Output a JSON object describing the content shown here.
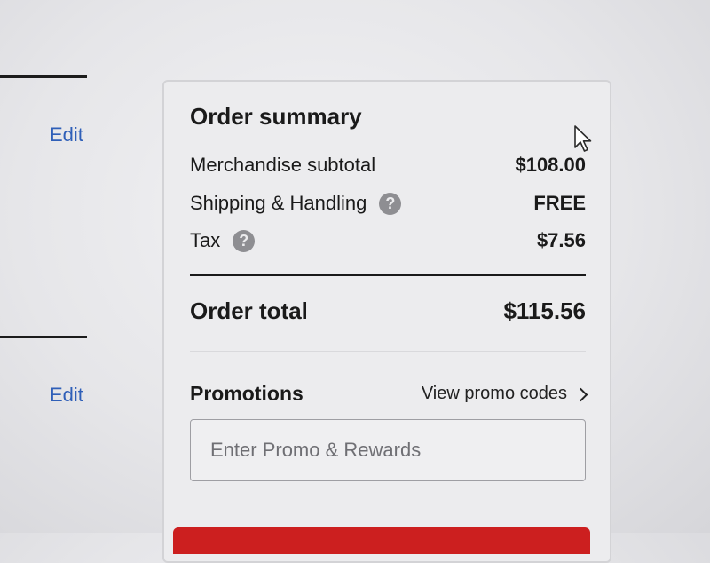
{
  "left": {
    "edit_links": [
      "Edit",
      "Edit"
    ]
  },
  "summary": {
    "title": "Order summary",
    "rows": [
      {
        "label": "Merchandise subtotal",
        "value": "$108.00",
        "help": false
      },
      {
        "label": "Shipping & Handling",
        "value": "FREE",
        "help": true
      },
      {
        "label": "Tax",
        "value": "$7.56",
        "help": true
      }
    ],
    "help_icon_glyph": "?",
    "total_label": "Order total",
    "total_value": "$115.56"
  },
  "promotions": {
    "title": "Promotions",
    "view_link": "View promo codes",
    "input_placeholder": "Enter Promo & Rewards",
    "input_value": ""
  },
  "colors": {
    "link": "#2f5fb8",
    "primary_button": "#cc1f1f",
    "help_icon": "#8e8e92"
  },
  "icons": [
    "help-icon",
    "chevron-right-icon",
    "mouse-cursor-icon"
  ]
}
